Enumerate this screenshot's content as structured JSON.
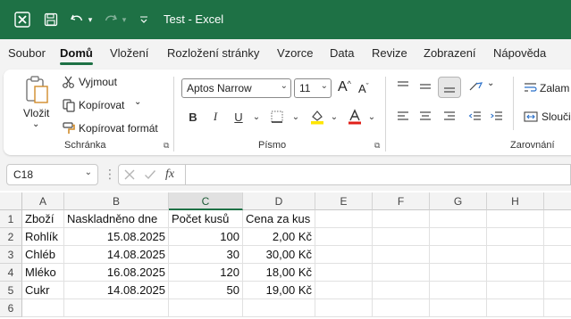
{
  "titlebar": {
    "title": "Test  -  Excel",
    "accent": "#1e7145"
  },
  "menu": {
    "tabs": [
      "Soubor",
      "Domů",
      "Vložení",
      "Rozložení stránky",
      "Vzorce",
      "Data",
      "Revize",
      "Zobrazení",
      "Nápověda"
    ],
    "active": "Domů"
  },
  "ribbon": {
    "clipboard": {
      "paste": "Vložit",
      "cut": "Vyjmout",
      "copy": "Kopírovat",
      "format_painter": "Kopírovat formát",
      "label": "Schránka"
    },
    "font": {
      "font_name": "Aptos Narrow",
      "font_size": "11",
      "label": "Písmo",
      "bold": "B",
      "italic": "I",
      "underline": "U",
      "grow": "A",
      "shrink": "A"
    },
    "alignment": {
      "wrap": "Zalam",
      "merge": "Slouči",
      "label": "Zarovnání"
    }
  },
  "formula_bar": {
    "name_box": "C18",
    "fx": "fx",
    "content": ""
  },
  "sheet": {
    "columns": [
      "A",
      "B",
      "C",
      "D",
      "E",
      "F",
      "G",
      "H"
    ],
    "selected_column": "C",
    "rows": [
      "1",
      "2",
      "3",
      "4",
      "5",
      "6"
    ],
    "headers": [
      "Zboží",
      "Naskladněno dne",
      "Počet kusů",
      "Cena za kus"
    ],
    "data": [
      [
        "Rohlík",
        "15.08.2025",
        "100",
        "2,00 Kč"
      ],
      [
        "Chléb",
        "14.08.2025",
        "30",
        "30,00 Kč"
      ],
      [
        "Mléko",
        "16.08.2025",
        "120",
        "18,00 Kč"
      ],
      [
        "Cukr",
        "14.08.2025",
        "50",
        "19,00 Kč"
      ]
    ]
  }
}
